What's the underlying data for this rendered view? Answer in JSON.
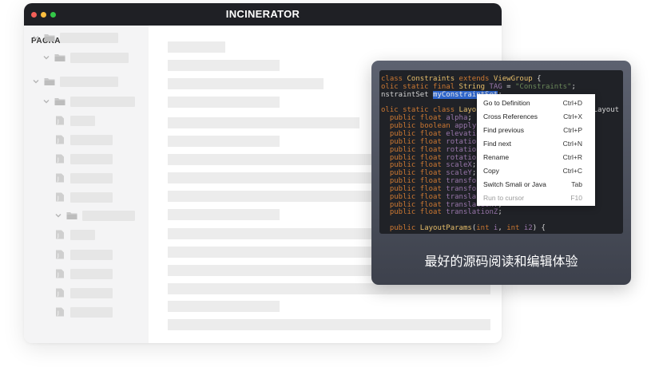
{
  "window": {
    "title": "INCINERATOR",
    "traffic_light_colors": [
      "#f25f58",
      "#fbbe3f",
      "#33c748"
    ]
  },
  "sidebar": {
    "header": "PACKAGE",
    "tree_nodes": [
      {
        "kind": "folder",
        "depth": 0,
        "expanded": true
      },
      {
        "kind": "folder",
        "depth": 1,
        "expanded": true
      },
      {
        "kind": "folder",
        "depth": 0,
        "expanded": true
      },
      {
        "kind": "folder",
        "depth": 1,
        "expanded": true
      },
      {
        "kind": "file",
        "depth": 2
      },
      {
        "kind": "file",
        "depth": 2
      },
      {
        "kind": "file",
        "depth": 2
      },
      {
        "kind": "file",
        "depth": 2
      },
      {
        "kind": "file",
        "depth": 2
      },
      {
        "kind": "folder",
        "depth": 2,
        "expanded": true
      },
      {
        "kind": "file",
        "depth": 2
      },
      {
        "kind": "file",
        "depth": 2
      },
      {
        "kind": "file",
        "depth": 2
      },
      {
        "kind": "file",
        "depth": 2
      },
      {
        "kind": "file",
        "depth": 2
      }
    ]
  },
  "editor": {
    "code_lines": [
      [
        {
          "t": "class ",
          "c": "kw"
        },
        {
          "t": "Constraints ",
          "c": "ty"
        },
        {
          "t": "extends ",
          "c": "kw"
        },
        {
          "t": "ViewGroup ",
          "c": "ty"
        },
        {
          "t": "{",
          "c": ""
        }
      ],
      [
        {
          "t": "olic ",
          "c": "kw"
        },
        {
          "t": "static ",
          "c": "kw"
        },
        {
          "t": "final ",
          "c": "kw"
        },
        {
          "t": "String ",
          "c": "ty"
        },
        {
          "t": "TAG",
          "c": "fld"
        },
        {
          "t": " = ",
          "c": ""
        },
        {
          "t": "\"Constraints\"",
          "c": "str"
        },
        {
          "t": ";",
          "c": ""
        }
      ],
      [
        {
          "t": "nstraintSet ",
          "c": ""
        },
        {
          "t": "myConstraintSet",
          "c": "sel"
        },
        {
          "t": ";",
          "c": ""
        }
      ],
      [],
      [
        {
          "t": "olic ",
          "c": "kw"
        },
        {
          "t": "static ",
          "c": "kw"
        },
        {
          "t": "class ",
          "c": "kw"
        },
        {
          "t": "LayoutParams ",
          "c": "ty"
        },
        {
          "t": "extends ",
          "c": "kw"
        },
        {
          "t": "ConstraintLayout",
          "c": ""
        }
      ],
      [
        {
          "t": "  public ",
          "c": "kw"
        },
        {
          "t": "float ",
          "c": "kw"
        },
        {
          "t": "alpha",
          "c": "fld"
        },
        {
          "t": ";",
          "c": ""
        }
      ],
      [
        {
          "t": "  public ",
          "c": "kw"
        },
        {
          "t": "boolean ",
          "c": "kw"
        },
        {
          "t": "applyElevation",
          "c": "fld"
        },
        {
          "t": ";",
          "c": ""
        }
      ],
      [
        {
          "t": "  public ",
          "c": "kw"
        },
        {
          "t": "float ",
          "c": "kw"
        },
        {
          "t": "elevation",
          "c": "fld"
        },
        {
          "t": ";",
          "c": ""
        }
      ],
      [
        {
          "t": "  public ",
          "c": "kw"
        },
        {
          "t": "float ",
          "c": "kw"
        },
        {
          "t": "rotation",
          "c": "fld"
        },
        {
          "t": ";",
          "c": ""
        }
      ],
      [
        {
          "t": "  public ",
          "c": "kw"
        },
        {
          "t": "float ",
          "c": "kw"
        },
        {
          "t": "rotationX",
          "c": "fld"
        },
        {
          "t": ";",
          "c": ""
        }
      ],
      [
        {
          "t": "  public ",
          "c": "kw"
        },
        {
          "t": "float ",
          "c": "kw"
        },
        {
          "t": "rotationY",
          "c": "fld"
        },
        {
          "t": ";",
          "c": ""
        }
      ],
      [
        {
          "t": "  public ",
          "c": "kw"
        },
        {
          "t": "float ",
          "c": "kw"
        },
        {
          "t": "scaleX",
          "c": "fld"
        },
        {
          "t": ";",
          "c": ""
        }
      ],
      [
        {
          "t": "  public ",
          "c": "kw"
        },
        {
          "t": "float ",
          "c": "kw"
        },
        {
          "t": "scaleY",
          "c": "fld"
        },
        {
          "t": ";",
          "c": ""
        }
      ],
      [
        {
          "t": "  public ",
          "c": "kw"
        },
        {
          "t": "float ",
          "c": "kw"
        },
        {
          "t": "transformPivotX",
          "c": "fld"
        },
        {
          "t": ";",
          "c": ""
        }
      ],
      [
        {
          "t": "  public ",
          "c": "kw"
        },
        {
          "t": "float ",
          "c": "kw"
        },
        {
          "t": "transformPivotY",
          "c": "fld"
        },
        {
          "t": ";",
          "c": ""
        }
      ],
      [
        {
          "t": "  public ",
          "c": "kw"
        },
        {
          "t": "float ",
          "c": "kw"
        },
        {
          "t": "translationX",
          "c": "fld"
        },
        {
          "t": ";",
          "c": ""
        }
      ],
      [
        {
          "t": "  public ",
          "c": "kw"
        },
        {
          "t": "float ",
          "c": "kw"
        },
        {
          "t": "translationY",
          "c": "fld"
        },
        {
          "t": ";",
          "c": ""
        }
      ],
      [
        {
          "t": "  public ",
          "c": "kw"
        },
        {
          "t": "float ",
          "c": "kw"
        },
        {
          "t": "translationZ",
          "c": "fld"
        },
        {
          "t": ";",
          "c": ""
        }
      ],
      [],
      [
        {
          "t": "  public ",
          "c": "kw"
        },
        {
          "t": "LayoutParams",
          "c": "ty"
        },
        {
          "t": "(",
          "c": ""
        },
        {
          "t": "int ",
          "c": "kw"
        },
        {
          "t": "i",
          "c": "fld"
        },
        {
          "t": ", ",
          "c": ""
        },
        {
          "t": "int ",
          "c": "kw"
        },
        {
          "t": "i2",
          "c": "fld"
        },
        {
          "t": ") {",
          "c": ""
        }
      ]
    ]
  },
  "context_menu": {
    "items": [
      {
        "label": "Go to Definition",
        "shortcut": "Ctrl+D",
        "enabled": true
      },
      {
        "label": "Cross References",
        "shortcut": "Ctrl+X",
        "enabled": true
      },
      {
        "label": "Find previous",
        "shortcut": "Ctrl+P",
        "enabled": true
      },
      {
        "label": "Find next",
        "shortcut": "Ctrl+N",
        "enabled": true
      },
      {
        "label": "Rename",
        "shortcut": "Ctrl+R",
        "enabled": true
      },
      {
        "label": "Copy",
        "shortcut": "Ctrl+C",
        "enabled": true
      },
      {
        "label": "Switch Smali or Java",
        "shortcut": "Tab",
        "enabled": true
      },
      {
        "label": "Run to cursor",
        "shortcut": "F10",
        "enabled": false
      }
    ]
  },
  "caption": "最好的源码阅读和编辑体验"
}
